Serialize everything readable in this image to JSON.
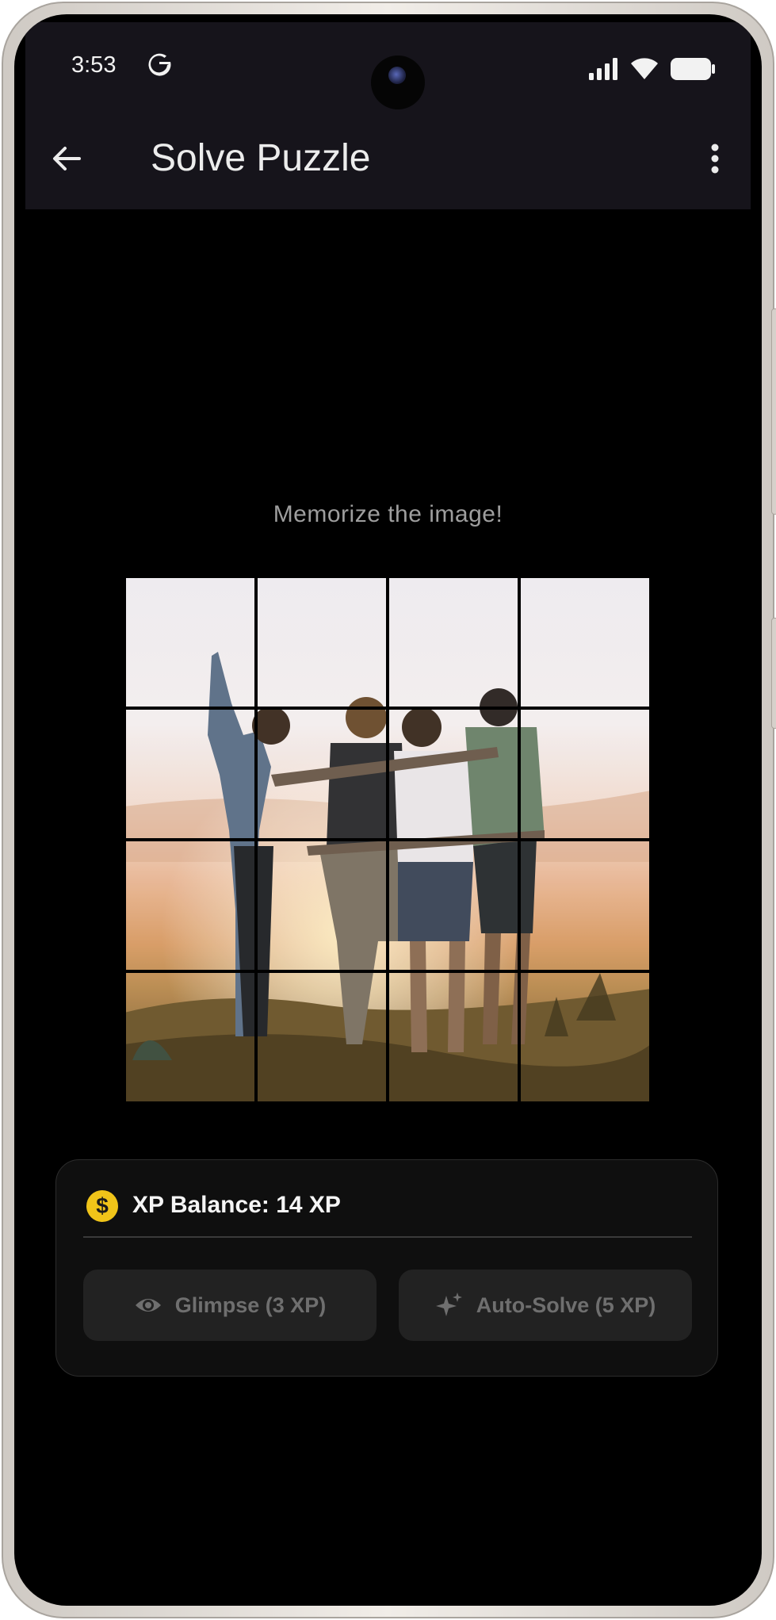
{
  "status_bar": {
    "time": "3:53"
  },
  "app_bar": {
    "title": "Solve Puzzle"
  },
  "puzzle": {
    "instruction": "Memorize the image!",
    "grid": {
      "rows": 4,
      "cols": 4
    },
    "image_description_icon": "puzzle-photo"
  },
  "xp_card": {
    "balance_text": "XP Balance: 14 XP",
    "coin_symbol": "$",
    "actions": [
      {
        "label": "Glimpse (3 XP)",
        "icon": "eye-icon"
      },
      {
        "label": "Auto-Solve (5 XP)",
        "icon": "sparkle-icon"
      }
    ]
  },
  "colors": {
    "background": "#000000",
    "app_bar": "#16141b",
    "coin": "#f0c419",
    "button_bg": "#222222",
    "button_text": "#6f6f6f"
  }
}
